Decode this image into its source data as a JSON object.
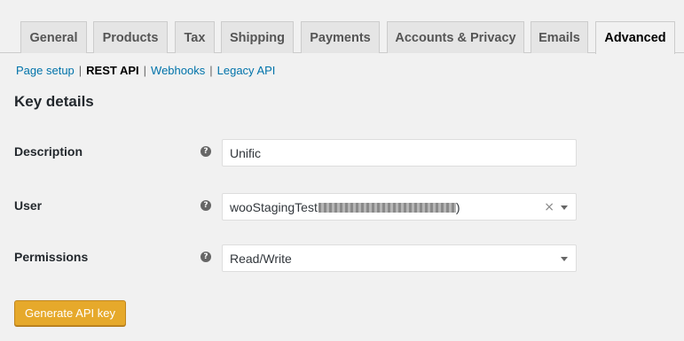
{
  "tabs": [
    {
      "label": "General"
    },
    {
      "label": "Products"
    },
    {
      "label": "Tax"
    },
    {
      "label": "Shipping"
    },
    {
      "label": "Payments"
    },
    {
      "label": "Accounts & Privacy"
    },
    {
      "label": "Emails"
    },
    {
      "label": "Advanced",
      "active": true
    }
  ],
  "subnav": {
    "page_setup": "Page setup",
    "rest_api": "REST API",
    "webhooks": "Webhooks",
    "legacy_api": "Legacy API",
    "separator": "|"
  },
  "section_title": "Key details",
  "form": {
    "description": {
      "label": "Description",
      "value": "Unific"
    },
    "user": {
      "label": "User",
      "value_prefix": "wooStagingTest",
      "value_suffix": ")"
    },
    "permissions": {
      "label": "Permissions",
      "value": "Read/Write"
    },
    "help_glyph": "?"
  },
  "clear_glyph": "×",
  "generate_button": "Generate API key",
  "colors": {
    "link": "#0073aa",
    "button": "#e6a92b",
    "background": "#f1f1f1"
  },
  "icons": {
    "help": "help-icon",
    "clear": "clear-icon",
    "dropdown": "chevron-down-icon"
  }
}
